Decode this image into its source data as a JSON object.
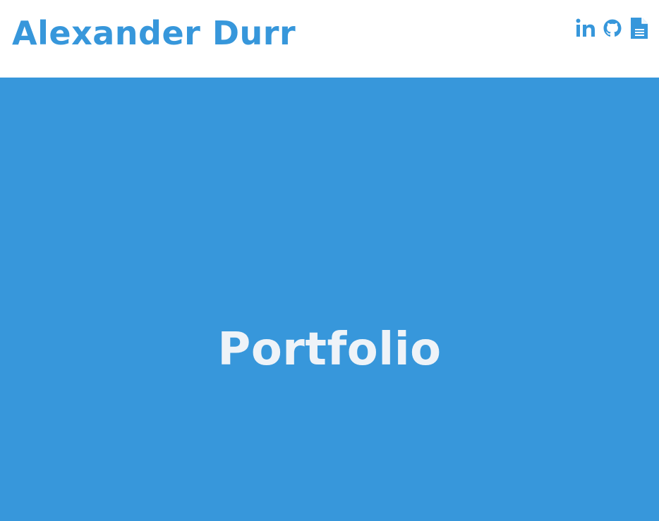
{
  "header": {
    "name": "Alexander Durr",
    "links": [
      {
        "icon": "linkedin-icon"
      },
      {
        "icon": "github-icon"
      },
      {
        "icon": "resume-document-icon"
      }
    ]
  },
  "hero": {
    "title": "Portfolio"
  },
  "colors": {
    "accent": "#3797db",
    "hero_text": "#eef3f8",
    "header_bg": "#ffffff"
  }
}
